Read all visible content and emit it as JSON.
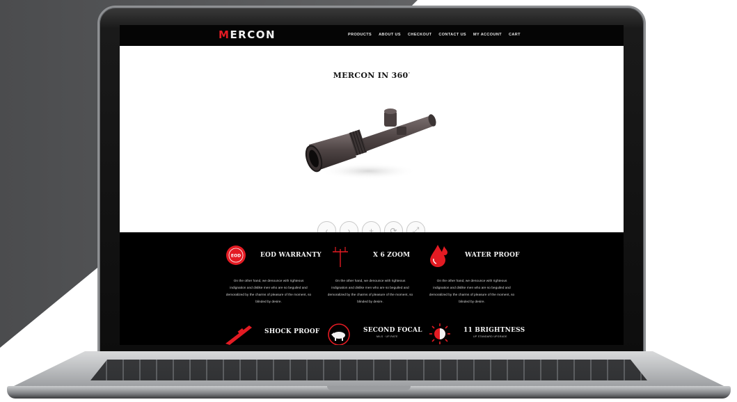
{
  "site": {
    "logo_text": "ERCON",
    "logo_initial": "M",
    "nav": [
      "PRODUCTS",
      "ABOUT US",
      "CHECKOUT",
      "CONTACT US",
      "MY ACCOUNT",
      "CART"
    ]
  },
  "hero": {
    "title": "MERCON IN 360",
    "title_sup": "°",
    "controls": [
      {
        "icon": "chevron-left-icon",
        "glyph": "‹"
      },
      {
        "icon": "chevron-right-icon",
        "glyph": "›"
      },
      {
        "icon": "zoom-in-icon",
        "glyph": "+"
      },
      {
        "icon": "rotate-icon",
        "glyph": "⟳"
      },
      {
        "icon": "fullscreen-icon",
        "glyph": "⤢"
      }
    ]
  },
  "features": [
    {
      "icon": "warranty-badge-icon",
      "badge": "EOD",
      "title": "EOD WARRANTY",
      "desc": "On the other hand, we denounce with righteous indignation and dislike men who are so beguiled and demoralized by the charms of pleasure of the moment, so blinded by desire."
    },
    {
      "icon": "crosshair-icon",
      "title": "X 6 ZOOM",
      "desc": "On the other hand, we denounce with righteous indignation and dislike men who are so beguiled and demoralized by the charms of pleasure of the moment, so blinded by desire."
    },
    {
      "icon": "water-drop-icon",
      "title": "WATER PROOF",
      "desc": "On the other hand, we denounce with righteous indignation and dislike men who are so beguiled and demoralized by the charms of pleasure of the moment, so blinded by desire."
    },
    {
      "icon": "rifle-icon",
      "title": "SHOCK PROOF"
    },
    {
      "icon": "boar-icon",
      "title": "SECOND FOCAL",
      "sub": "MILS · UP-RATE"
    },
    {
      "icon": "brightness-icon",
      "title": "11 BRIGHTNESS",
      "sub": "UP STANDARD UPGRADE"
    }
  ],
  "colors": {
    "accent": "#e31b23",
    "background_panel": "#5a5a5c",
    "screen_bg": "#000000"
  }
}
